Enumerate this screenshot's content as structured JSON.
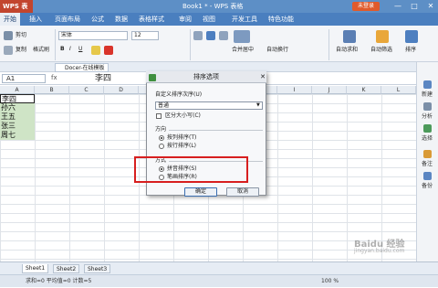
{
  "titlebar": {
    "app": "WPS 表格",
    "window_title": "Book1 * - WPS 表格",
    "login_label": "未登录",
    "controls": [
      "—",
      "□",
      "✕"
    ]
  },
  "menu": {
    "tabs": [
      "开始",
      "插入",
      "页面布局",
      "公式",
      "数据",
      "表格样式",
      "审阅",
      "视图",
      "开发工具",
      "特色功能"
    ],
    "active": 0
  },
  "ribbon": {
    "cut": "剪切",
    "copy": "复制",
    "format_painter": "格式刷",
    "font_name": "宋体",
    "font_size": "12",
    "merge_center": "合并居中",
    "wrap_text": "自动换行",
    "auto_sum": "自动求和",
    "auto_filter": "自动筛选",
    "sort": "排序"
  },
  "doctabs": [
    "Docer-在线模板",
    "Book1 *"
  ],
  "formula_bar": {
    "name_box": "A1",
    "fx": "fx",
    "value": "李四"
  },
  "columns": [
    "A",
    "B",
    "C",
    "D",
    "E",
    "F",
    "G",
    "H",
    "I",
    "J",
    "K",
    "L"
  ],
  "cells": [
    "李四",
    "孙六",
    "王五",
    "张三",
    "周七"
  ],
  "side_panel": [
    "新建",
    "分析",
    "选择",
    "备注",
    "备份"
  ],
  "sheets": [
    "Sheet1",
    "Sheet2",
    "Sheet3"
  ],
  "status": {
    "summary": "求和=0   平均值=0   计数=5",
    "zoom": "100 %"
  },
  "dialog": {
    "title": "排序选项",
    "custom_order_label": "自定义排序次序(U)",
    "custom_order_value": "普通",
    "case_sensitive": "区分大小写(C)",
    "direction_label": "方向",
    "by_column": "按列排序(T)",
    "by_row": "按行排序(L)",
    "method_label": "方式",
    "pinyin": "拼音排序(S)",
    "stroke": "笔画排序(R)",
    "ok": "确定",
    "cancel": "取消"
  },
  "watermark": {
    "text": "Baidu 经验",
    "url": "jingyan.baidu.com"
  }
}
